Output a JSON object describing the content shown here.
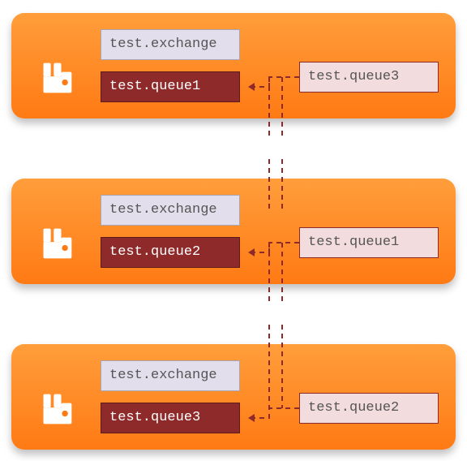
{
  "nodes": [
    {
      "exchange": "test.exchange",
      "primary_queue": "test.queue1",
      "secondary_queue": "test.queue3"
    },
    {
      "exchange": "test.exchange",
      "primary_queue": "test.queue2",
      "secondary_queue": "test.queue1"
    },
    {
      "exchange": "test.exchange",
      "primary_queue": "test.queue3",
      "secondary_queue": "test.queue2"
    }
  ],
  "colors": {
    "node_gradient_top": "#ff9e3b",
    "node_gradient_bottom": "#ff7a14",
    "exchange_bg": "#e2deec",
    "queue_dark_bg": "#8f2a2a",
    "queue_light_bg": "#f3dcdd",
    "connector": "#8f2a2a"
  }
}
